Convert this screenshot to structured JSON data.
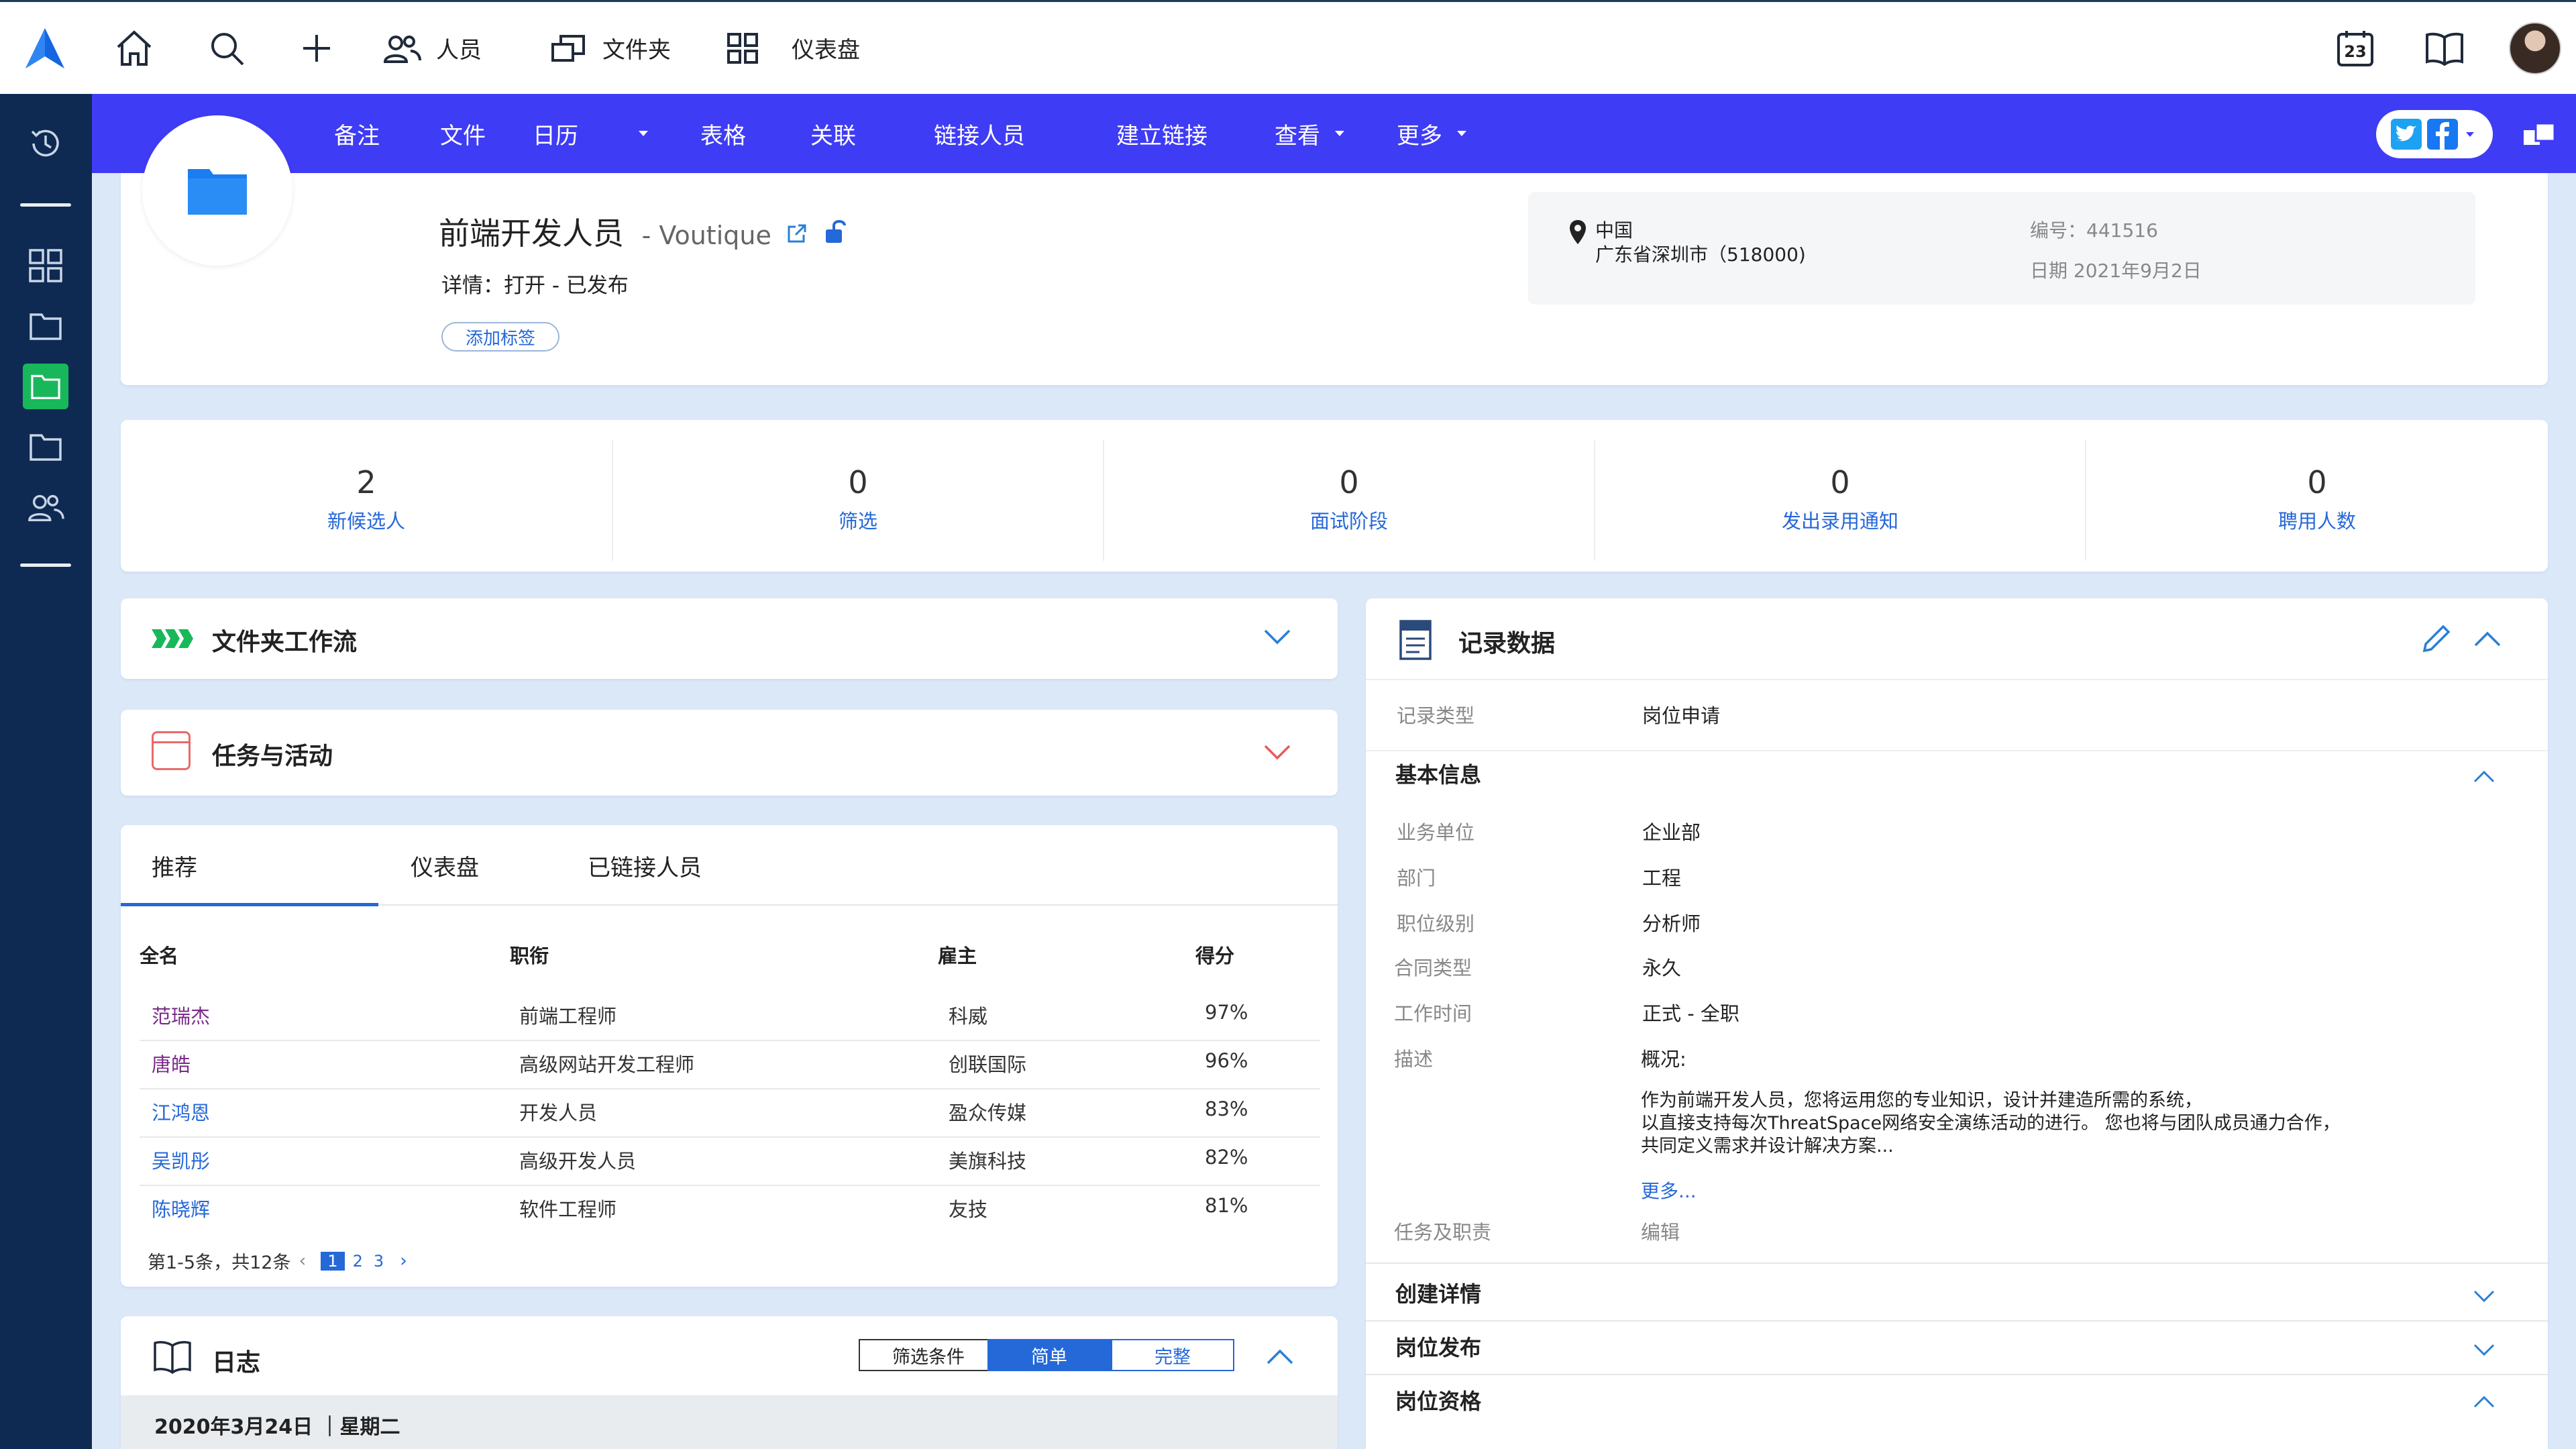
{
  "topnav": {
    "people_label": "人员",
    "folders_label": "文件夹",
    "dashboard_label": "仪表盘",
    "calendar_day": "23"
  },
  "subnav": {
    "items": [
      "备注",
      "文件",
      "日历",
      "表格",
      "关联",
      "链接人员",
      "建立链接",
      "查看",
      "更多"
    ]
  },
  "header": {
    "title": "前端开发人员",
    "company": "- Voutique",
    "details": "详情：打开 - 已发布",
    "add_tag": "添加标签",
    "location_country": "中国",
    "location_city": "广东省深圳市（518000)",
    "number": "编号：441516",
    "date": "日期 2021年9月2日"
  },
  "stats": [
    {
      "value": "2",
      "label": "新候选人"
    },
    {
      "value": "0",
      "label": "筛选"
    },
    {
      "value": "0",
      "label": "面试阶段"
    },
    {
      "value": "0",
      "label": "发出录用通知"
    },
    {
      "value": "0",
      "label": "聘用人数"
    }
  ],
  "workflow": {
    "title": "文件夹工作流"
  },
  "tasks": {
    "title": "任务与活动"
  },
  "candidates": {
    "tabs": [
      "推荐",
      "仪表盘",
      "已链接人员"
    ],
    "headers": [
      "全名",
      "职衔",
      "雇主",
      "得分"
    ],
    "rows": [
      {
        "name": "范瑞杰",
        "title": "前端工程师",
        "employer": "科威",
        "score": "97%"
      },
      {
        "name": "唐皓",
        "title": "高级网站开发工程师",
        "employer": "创联国际",
        "score": "96%"
      },
      {
        "name": "江鸿恩",
        "title": "开发人员",
        "employer": "盈众传媒",
        "score": "83%"
      },
      {
        "name": "吴凯彤",
        "title": "高级开发人员",
        "employer": "美旗科技",
        "score": "82%"
      },
      {
        "name": "陈晓辉",
        "title": "软件工程师",
        "employer": "友技",
        "score": "81%"
      }
    ],
    "pagination_text": "第1-5条，共12条",
    "pages": [
      "1",
      "2",
      "3"
    ]
  },
  "log": {
    "title": "日志",
    "filter_label": "筛选条件",
    "simple_label": "简单",
    "full_label": "完整",
    "date_label": "2020年3月24日 ｜星期二"
  },
  "record": {
    "title": "记录数据",
    "record_type_label": "记录类型",
    "record_type_value": "岗位申请",
    "basic_info_title": "基本信息",
    "fields": [
      {
        "label": "业务单位",
        "value": "企业部"
      },
      {
        "label": "部门",
        "value": "工程"
      },
      {
        "label": "职位级别",
        "value": "分析师"
      },
      {
        "label": "合同类型",
        "value": "永久"
      },
      {
        "label": "工作时间",
        "value": "正式 - 全职"
      }
    ],
    "desc_label": "描述",
    "desc_heading": "概况:",
    "desc_line1": "作为前端开发人员，您将运用您的专业知识，设计并建造所需的系统，",
    "desc_line2": "以直接支持每次ThreatSpace网络安全演练活动的进行。 您也将与团队成员通力合作，",
    "desc_line3": "共同定义需求并设计解决方案...",
    "more_link": "更多...",
    "duties_label": "任务及职责",
    "duties_value": "编辑",
    "sections": [
      "创建详情",
      "岗位发布",
      "岗位资格"
    ]
  }
}
